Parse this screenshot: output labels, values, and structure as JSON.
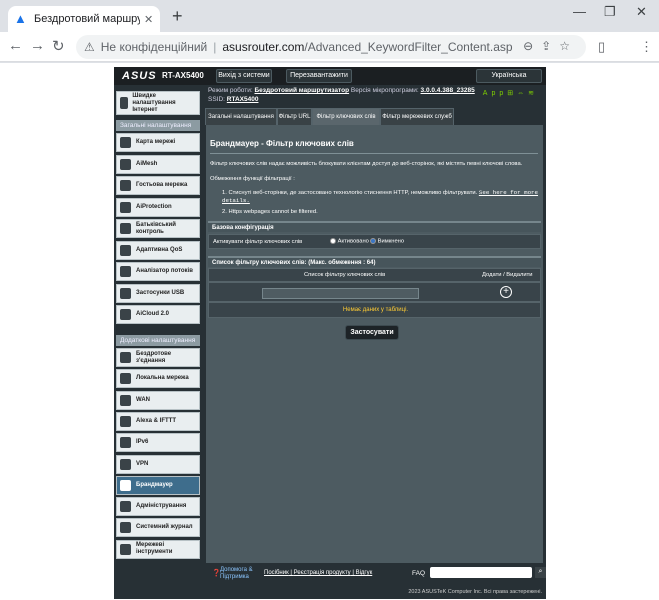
{
  "browser": {
    "tab_title": "Бездротовий маршрутизатор ASUS",
    "tab_close": "✕",
    "new_tab": "+",
    "minimize": "—",
    "maximize": "❐",
    "close": "✕",
    "back": "←",
    "forward": "→",
    "reload": "↻",
    "security_icon": "⚠",
    "security_label": "Не конфіденційний",
    "url_domain": "asusrouter.com",
    "url_path": "/Advanced_KeywordFilter_Content.asp"
  },
  "router": {
    "logo": "ASUS",
    "model": "RT-AX5400",
    "logout_label": "Вихід з системи",
    "reboot_label": "Перезавантажити",
    "language": "Українська",
    "info": {
      "mode_label": "Режим роботи:",
      "mode_value": "Бездротовий маршрутизатор",
      "firmware_label": "Версія мікропрограми:",
      "firmware_value": "3.0.0.4.388_23285",
      "ssid_label": "SSID:",
      "ssid_value": "RTAX5400",
      "app_label": "App"
    },
    "sidebar": {
      "quick_setup": "Швидке налаштування Інтернет",
      "general_header": "Загальні налаштування",
      "general_items": [
        "Карта мережі",
        "AiMesh",
        "Гостьова мережа",
        "AiProtection",
        "Батьківський контроль",
        "Адаптивна QoS",
        "Аналізатор потоків",
        "Застосунки USB",
        "AiCloud 2.0"
      ],
      "advanced_header": "Додаткові налаштування",
      "advanced_items": [
        "Бездротове з'єднання",
        "Локальна мережа",
        "WAN",
        "Alexa & IFTTT",
        "IPv6",
        "VPN",
        "Брандмауер",
        "Адміністрування",
        "Системний журнал",
        "Мережеві інструменти"
      ]
    },
    "tabs": [
      "Загальні налаштування",
      "Фільтр URL",
      "Фільтр ключових слів",
      "Фільтр мережевих служб"
    ],
    "content": {
      "title": "Брандмауер - Фільтр ключових слів",
      "description": "Фільтр ключових слів надає можливість блокувати клієнтам доступ до веб-сторінок, які містять певні ключові слова.",
      "limits_title": "Обмеження функції фільтрації :",
      "limit_1": "1. Стиснуті веб-сторінки, де застосовано технологію стиснення HTTP, неможливо фільтрувати.",
      "limit_1_link": "See here for more details.",
      "limit_2": "2. Https webpages cannot be filtered.",
      "basic_header": "Базова конфігурація",
      "enable_label": "Активувати фільтр ключових слів",
      "radio_on": "Активовано",
      "radio_off": "Вимкнено",
      "list_header": "Список фільтру ключових слів: (Макс. обмеження : 64)",
      "col_list": "Список фільтру ключових слів",
      "col_addremove": "Додати / Видалити",
      "plus": "+",
      "no_data": "Немає даних у таблиці.",
      "apply_label": "Застосувати"
    },
    "footer": {
      "help_label": "Допомога & Підтримка",
      "manual_label": "Посібник",
      "registration_label": "Реєстрація продукту",
      "feedback_label": "Відгук",
      "faq_label": "FAQ",
      "search_icon": "⌕",
      "copyright": "2023 ASUSTeK Computer Inc. Всі права застережені."
    }
  }
}
